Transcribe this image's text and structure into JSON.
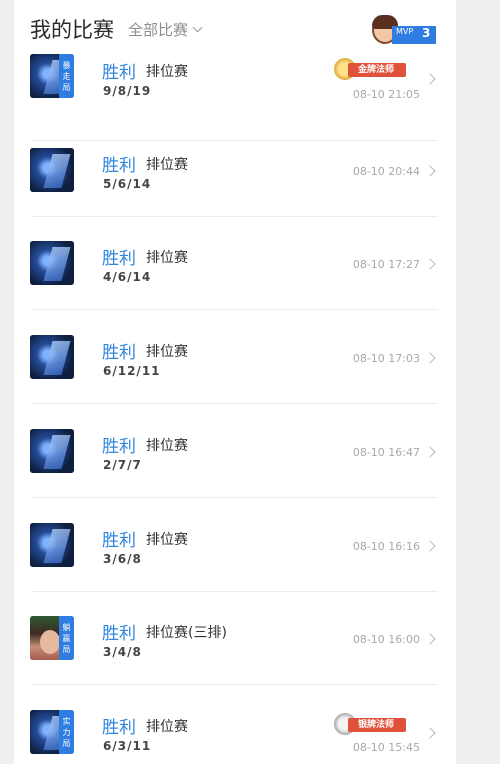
{
  "header": {
    "title": "我的比赛",
    "filter_label": "全部比赛",
    "mvp_label": "MVP",
    "mvp_count": "3"
  },
  "matches": [
    {
      "result": "胜利",
      "mode": "排位赛",
      "kda": "9/8/19",
      "time": "08-10 21:05",
      "avatar": "ai",
      "tag": "暴走局",
      "honor": "金牌法师"
    },
    {
      "result": "胜利",
      "mode": "排位赛",
      "kda": "5/6/14",
      "time": "08-10 20:44",
      "avatar": "ai",
      "tag": "",
      "honor": ""
    },
    {
      "result": "胜利",
      "mode": "排位赛",
      "kda": "4/6/14",
      "time": "08-10 17:27",
      "avatar": "ai",
      "tag": "",
      "honor": ""
    },
    {
      "result": "胜利",
      "mode": "排位赛",
      "kda": "6/12/11",
      "time": "08-10 17:03",
      "avatar": "ai",
      "tag": "",
      "honor": ""
    },
    {
      "result": "胜利",
      "mode": "排位赛",
      "kda": "2/7/7",
      "time": "08-10 16:47",
      "avatar": "ai",
      "tag": "",
      "honor": ""
    },
    {
      "result": "胜利",
      "mode": "排位赛",
      "kda": "3/6/8",
      "time": "08-10 16:16",
      "avatar": "ai",
      "tag": "",
      "honor": ""
    },
    {
      "result": "胜利",
      "mode": "排位赛(三排)",
      "kda": "3/4/8",
      "time": "08-10 16:00",
      "avatar": "girl",
      "tag": "躺赢局",
      "honor": ""
    },
    {
      "result": "胜利",
      "mode": "排位赛",
      "kda": "6/3/11",
      "time": "08-10 15:45",
      "avatar": "ai",
      "tag": "实力局",
      "honor": "银牌法师"
    }
  ]
}
